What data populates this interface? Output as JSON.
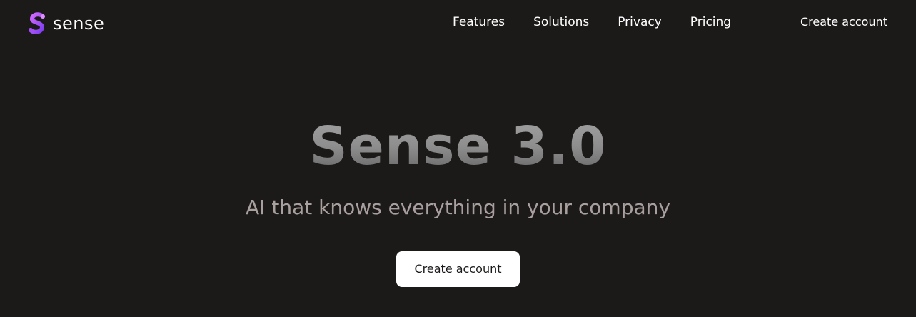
{
  "brand": {
    "name": "sense",
    "logo_icon": "sense-s-logo-icon",
    "logo_gradient": [
      "#c45cf0",
      "#7b3ff2"
    ]
  },
  "nav": {
    "links": [
      {
        "label": "Features"
      },
      {
        "label": "Solutions"
      },
      {
        "label": "Privacy"
      },
      {
        "label": "Pricing"
      }
    ],
    "cta_label": "Create account"
  },
  "hero": {
    "title": "Sense 3.0",
    "subtitle": "AI that knows everything in your company",
    "button_label": "Create account"
  },
  "colors": {
    "background": "#1c1a19",
    "text": "#ffffff",
    "subtitle": "#a89f9e",
    "button_bg": "#ffffff",
    "button_text": "#1c1a19"
  }
}
